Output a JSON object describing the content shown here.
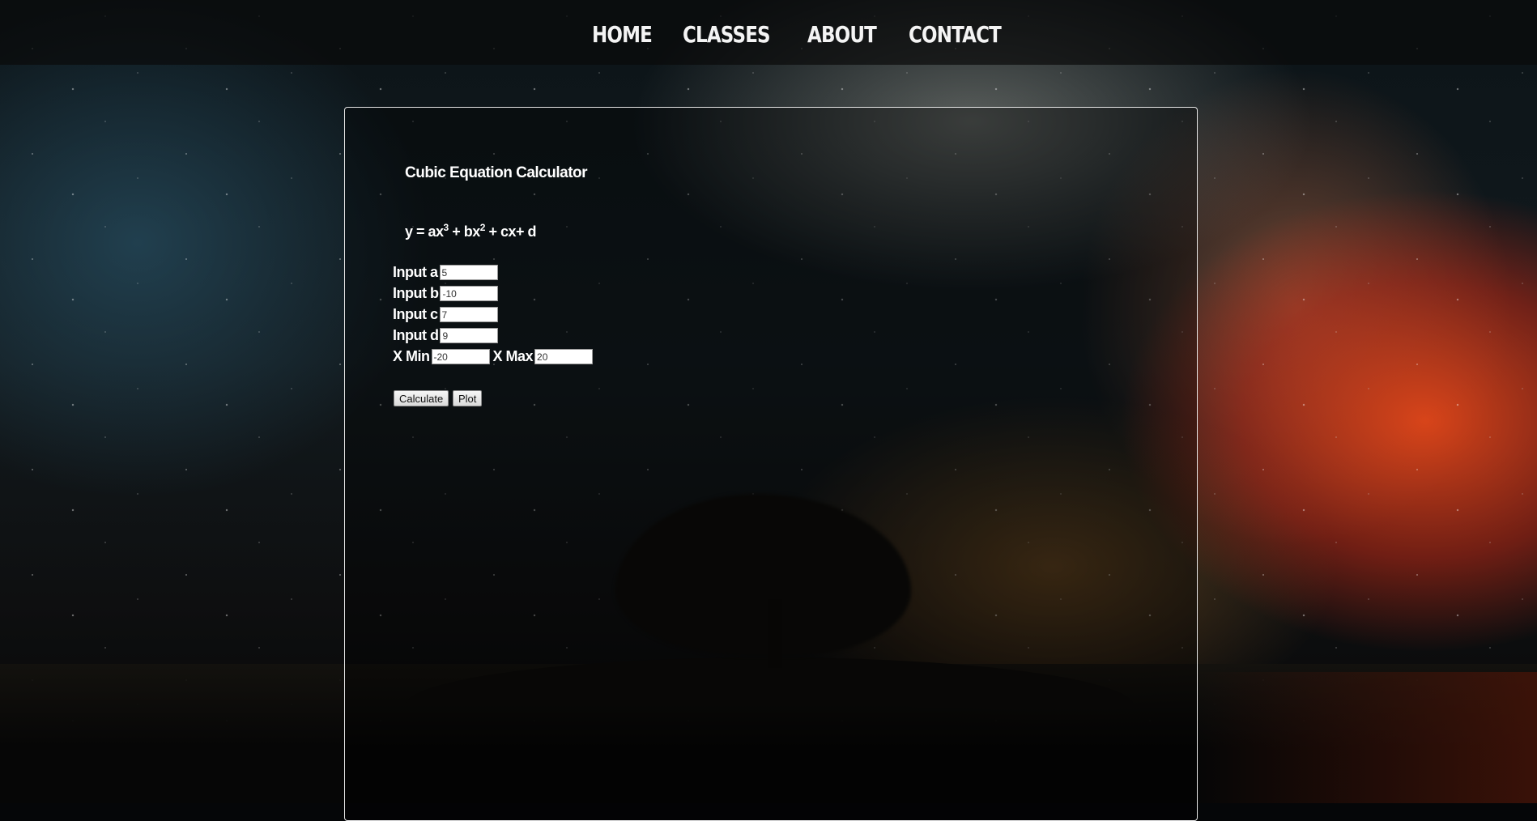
{
  "nav": {
    "items": [
      {
        "label": "HOME"
      },
      {
        "label": "CLASSES"
      },
      {
        "label": "ABOUT"
      },
      {
        "label": "CONTACT"
      }
    ]
  },
  "calculator": {
    "title": "Cubic Equation Calculator",
    "formula": {
      "prefix": "y = ax",
      "exp1": "3",
      "mid": " + bx",
      "exp2": "2",
      "suffix": " + cx+ d"
    },
    "inputs": {
      "a": {
        "label": "Input a",
        "value": "5"
      },
      "b": {
        "label": "Input b",
        "value": "-10"
      },
      "c": {
        "label": "Input c",
        "value": "7"
      },
      "d": {
        "label": "Input d",
        "value": "9"
      },
      "xmin": {
        "label": "X Min",
        "value": "-20"
      },
      "xmax": {
        "label": "X Max",
        "value": "20"
      }
    },
    "buttons": {
      "calculate": "Calculate",
      "plot": "Plot"
    }
  }
}
